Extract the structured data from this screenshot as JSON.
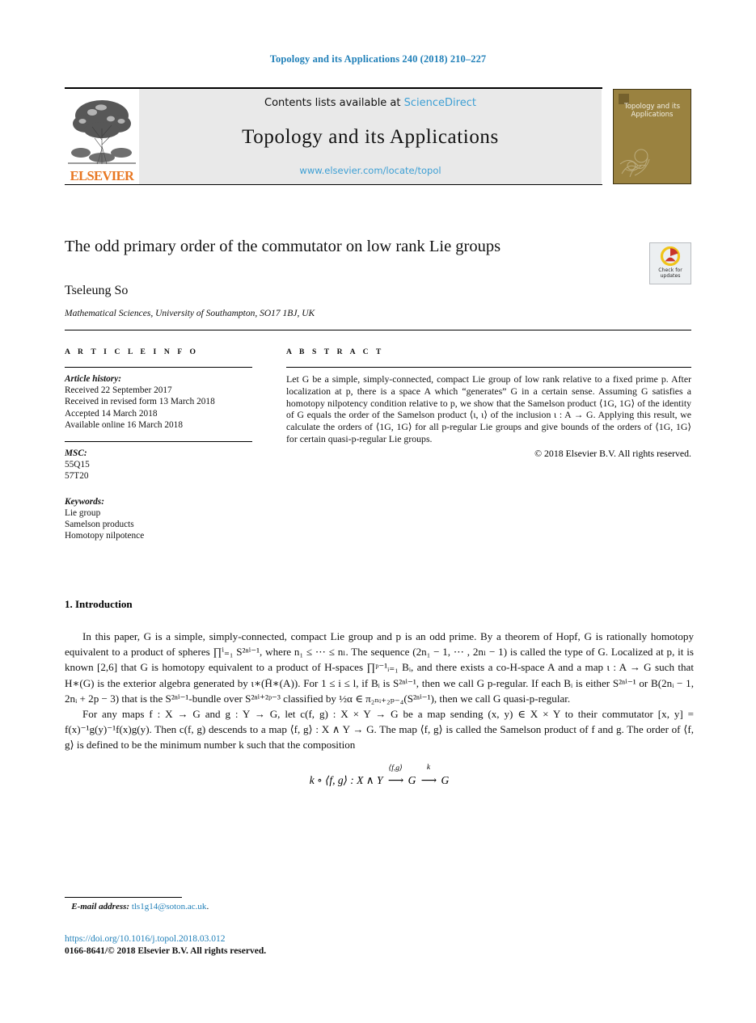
{
  "running_head": "Topology and its Applications 240 (2018) 210–227",
  "masthead": {
    "contents_prefix": "Contents lists available at ",
    "sciencedirect_link": "ScienceDirect",
    "journal_title": "Topology and its Applications",
    "journal_url": "www.elsevier.com/locate/topol",
    "publisher_wordmark": "ELSEVIER",
    "cover_title": "Topology and its Applications",
    "accent_link_color": "#3d9fd4",
    "cover_color": "#9a8240",
    "publisher_color": "#e87722"
  },
  "title_block": {
    "title": "The odd primary order of the commutator on low rank Lie groups",
    "author": "Tseleung So",
    "affiliation": "Mathematical Sciences, University of Southampton, SO17 1BJ, UK",
    "crossmark_line1": "Check for",
    "crossmark_line2": "updates"
  },
  "article_info": {
    "label": "A R T I C L E   I N F O",
    "history_head": "Article history:",
    "history": [
      "Received 22 September 2017",
      "Received in revised form 13 March 2018",
      "Accepted 14 March 2018",
      "Available online 16 March 2018"
    ],
    "msc_head": "MSC:",
    "msc": [
      "55Q15",
      "57T20"
    ],
    "keywords_head": "Keywords:",
    "keywords": [
      "Lie group",
      "Samelson products",
      "Homotopy nilpotence"
    ]
  },
  "abstract": {
    "label": "A B S T R A C T",
    "text": "Let G be a simple, simply-connected, compact Lie group of low rank relative to a fixed prime p. After localization at p, there is a space A which “generates” G in a certain sense. Assuming G satisfies a homotopy nilpotency condition relative to p, we show that the Samelson product ⟨1G, 1G⟩ of the identity of G equals the order of the Samelson product ⟨ɩ, ɩ⟩ of the inclusion ɩ : A → G. Applying this result, we calculate the orders of ⟨1G, 1G⟩ for all p-regular Lie groups and give bounds of the orders of ⟨1G, 1G⟩ for certain quasi-p-regular Lie groups.",
    "copyright": "© 2018 Elsevier B.V. All rights reserved."
  },
  "body": {
    "section_heading": "1. Introduction",
    "paragraph_1": "In this paper, G is a simple, simply-connected, compact Lie group and p is an odd prime. By a theorem of Hopf, G is rationally homotopy equivalent to a product of spheres ∏ⁱ₌₁ S²ⁿⁱ⁻¹, where n₁ ≤ ⋯ ≤ nₗ. The sequence (2n₁ − 1, ⋯ , 2nₗ − 1) is called the type of G. Localized at p, it is known [2,6] that G is homotopy equivalent to a product of H-spaces ∏ᵖ⁻¹ᵢ₌₁ Bᵢ, and there exists a co-H-space A and a map ɩ : A → G such that H∗(G) is the exterior algebra generated by ɩ∗(H̄∗(A)). For 1 ≤ i ≤ l, if Bᵢ is S²ⁿⁱ⁻¹, then we call G p-regular. If each Bᵢ is either S²ⁿⁱ⁻¹ or B(2nᵢ − 1, 2nᵢ + 2p − 3) that is the S²ⁿⁱ⁻¹-bundle over S²ⁿⁱ⁺²ᵖ⁻³ classified by ½α ∈ π₂ₙᵢ₊₂ₚ₋₄(S²ⁿⁱ⁻¹), then we call G quasi-p-regular.",
    "citation_reference": "[2,6]",
    "paragraph_2": "For any maps f : X → G and g : Y → G, let c(f, g) : X × Y → G be a map sending (x, y) ∈ X × Y to their commutator [x, y] = f(x)⁻¹g(y)⁻¹f(x)g(y). Then c(f, g) descends to a map ⟨f, g⟩ : X ∧ Y → G. The map ⟨f, g⟩ is called the Samelson product of f and g. The order of ⟨f, g⟩ is defined to be the minimum number k such that the composition",
    "equation": {
      "lhs": "k ∘ ⟨f, g⟩ : X ∧ Y",
      "arrow1_label": "⟨f,g⟩",
      "mid": "G",
      "arrow2_label": "k",
      "rhs": "G"
    }
  },
  "footer": {
    "email_label": "E-mail address:",
    "email": "tls1g14@soton.ac.uk",
    "email_trailing": ".",
    "doi": "https://doi.org/10.1016/j.topol.2018.03.012",
    "issn_line": "0166-8641/© 2018 Elsevier B.V. All rights reserved."
  }
}
